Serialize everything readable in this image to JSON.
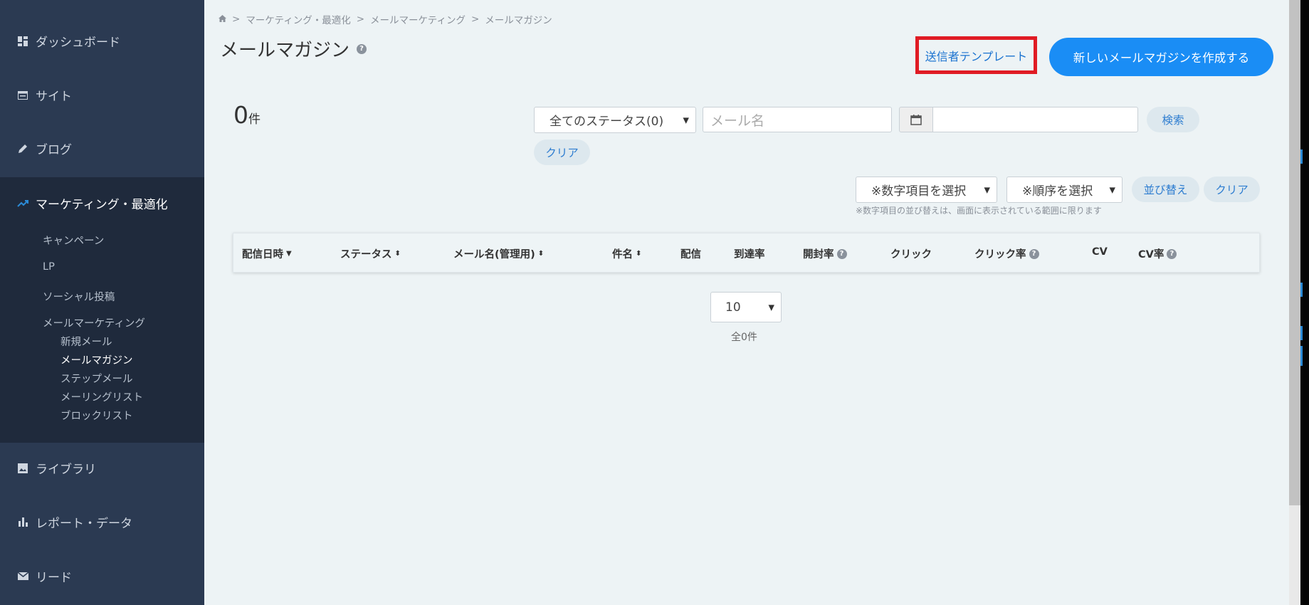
{
  "sidebar": {
    "items": [
      {
        "label": "ダッシュボード",
        "icon": "dashboard-icon"
      },
      {
        "label": "サイト",
        "icon": "site-icon"
      },
      {
        "label": "ブログ",
        "icon": "pencil-icon"
      },
      {
        "label": "マーケティング・最適化",
        "icon": "trend-icon"
      },
      {
        "label": "ライブラリ",
        "icon": "image-icon"
      },
      {
        "label": "レポート・データ",
        "icon": "bar-chart-icon"
      },
      {
        "label": "リード",
        "icon": "mail-icon"
      }
    ],
    "sub_items": [
      "キャンペーン",
      "LP",
      "ソーシャル投稿",
      "メールマーケティング"
    ],
    "email_sub_items": [
      "新規メール",
      "メールマガジン",
      "ステップメール",
      "メーリングリスト",
      "ブロックリスト"
    ]
  },
  "breadcrumb": [
    "マーケティング・最適化",
    "メールマーケティング",
    "メールマガジン"
  ],
  "page_title": "メールマガジン",
  "buttons": {
    "sender_template": "送信者テンプレート",
    "create": "新しいメールマガジンを作成する",
    "search": "検索",
    "clear": "クリア",
    "sort": "並び替え",
    "sort_clear": "クリア"
  },
  "count": {
    "value": "0",
    "unit": "件"
  },
  "filters": {
    "status_selected": "全てのステータス(0)",
    "mail_name_placeholder": "メール名",
    "numeric_item_selected": "※数字項目を選択",
    "order_selected": "※順序を選択",
    "sort_note": "※数字項目の並び替えは、画面に表示されている範囲に限ります"
  },
  "table": {
    "headers": [
      "配信日時",
      "ステータス",
      "メール名(管理用)",
      "件名",
      "配信",
      "到達率",
      "開封率",
      "クリック",
      "クリック率",
      "CV",
      "CV率"
    ]
  },
  "pagination": {
    "per_page": "10",
    "total": "全0件"
  }
}
